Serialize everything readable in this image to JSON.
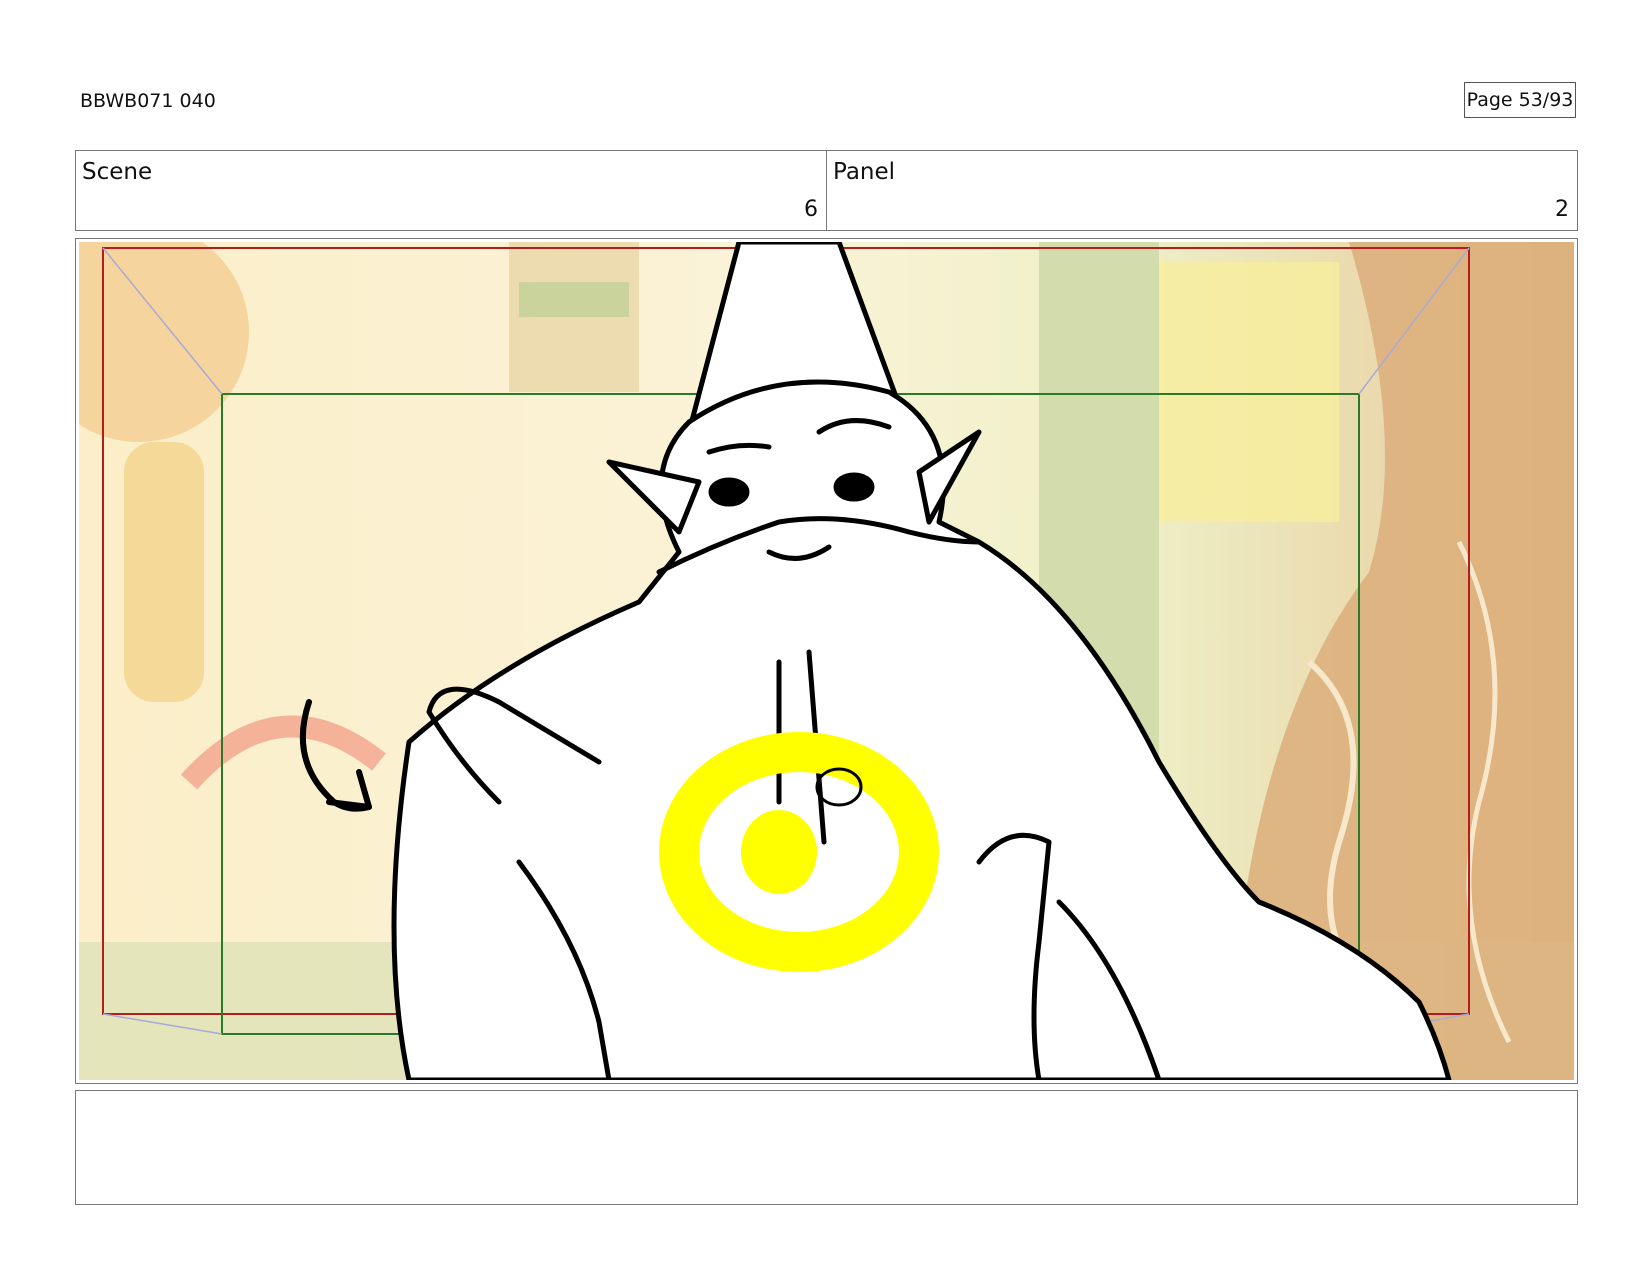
{
  "header": {
    "doc_id": "BBWB071 040",
    "page": "Page 53/93"
  },
  "info": {
    "scene_label": "Scene",
    "scene_value": "6",
    "panel_label": "Panel",
    "panel_value": "2"
  },
  "panel_image": {
    "description_icon": "storyboard-sketch-gnome-wizard",
    "colors": {
      "safe_frame": "#b21e1e",
      "action_frame": "#2a7a2a",
      "glow": "#ffff00",
      "background_warm": "#f6e6b4"
    }
  },
  "notes": {
    "text": ""
  }
}
